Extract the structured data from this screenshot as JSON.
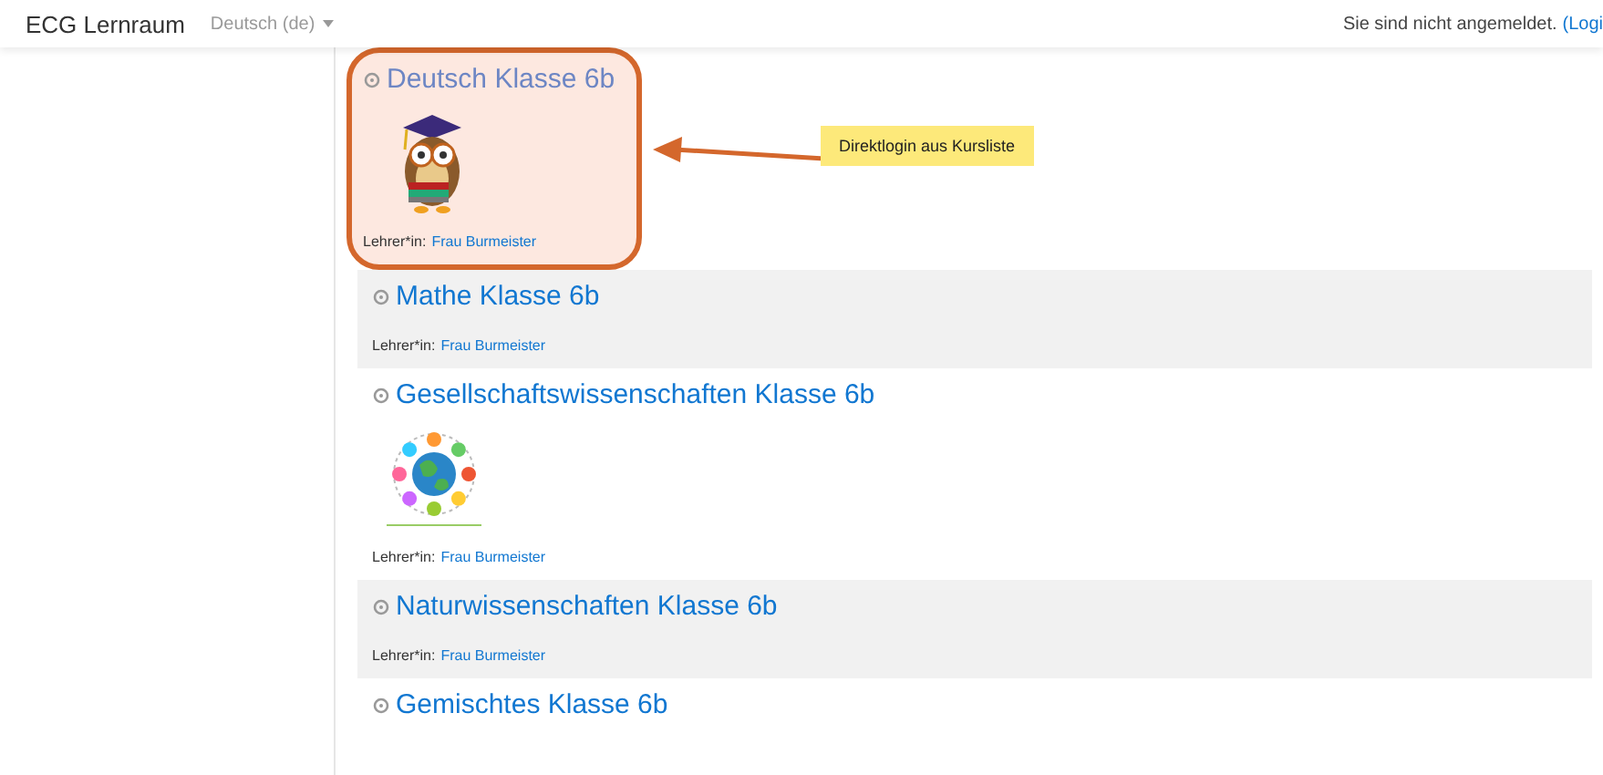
{
  "navbar": {
    "brand": "ECG Lernraum",
    "language": "Deutsch (de)",
    "login_status": "Sie sind nicht angemeldet.",
    "login_link": "(Logi"
  },
  "courses": [
    {
      "title": "Deutsch Klasse 6b",
      "kind": "owl-image",
      "teacher_label": "Lehrer*in:",
      "teacher": "Frau Burmeister",
      "highlighted": true
    },
    {
      "title": "Mathe Klasse 6b",
      "kind": "text-only",
      "teacher_label": "Lehrer*in:",
      "teacher": "Frau Burmeister",
      "highlighted": false
    },
    {
      "title": "Gesellschaftswissenschaften Klasse 6b",
      "kind": "globe-image",
      "teacher_label": "Lehrer*in:",
      "teacher": "Frau Burmeister",
      "highlighted": false
    },
    {
      "title": "Naturwissenschaften Klasse 6b",
      "kind": "text-only",
      "teacher_label": "Lehrer*in:",
      "teacher": "Frau Burmeister",
      "highlighted": false
    },
    {
      "title": "Gemischtes Klasse 6b",
      "kind": "text-only",
      "highlighted": false
    }
  ],
  "annotation": {
    "note": "Direktlogin aus Kursliste"
  }
}
